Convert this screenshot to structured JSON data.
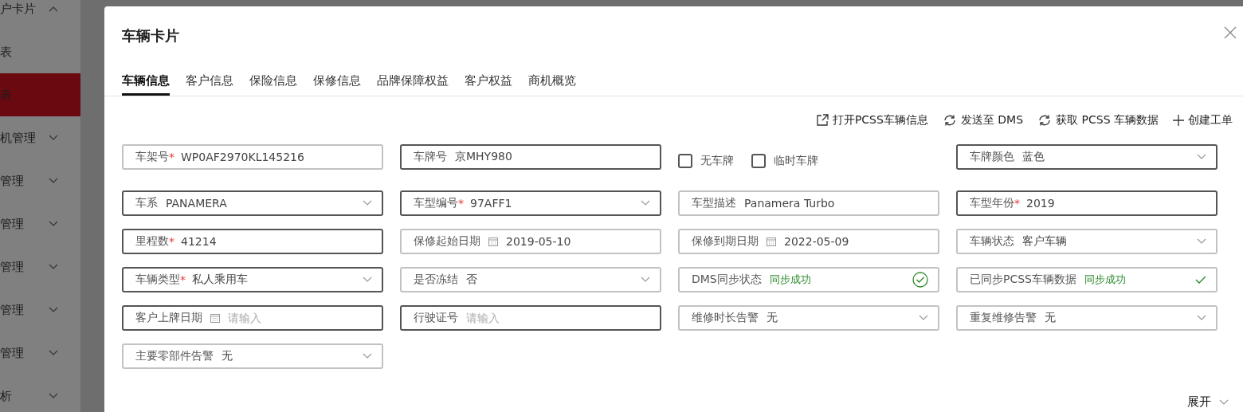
{
  "sidebar": {
    "items": [
      {
        "kind": "group",
        "label": "户卡片",
        "expanded": true,
        "selected": false
      },
      {
        "kind": "leaf",
        "label": "表",
        "selected": false
      },
      {
        "kind": "leaf",
        "label": "表",
        "selected": true
      },
      {
        "kind": "group",
        "label": "机管理",
        "expanded": false,
        "selected": false
      },
      {
        "kind": "group",
        "label": "管理",
        "expanded": false,
        "selected": false
      },
      {
        "kind": "group",
        "label": "管理",
        "expanded": false,
        "selected": false
      },
      {
        "kind": "group",
        "label": "管理",
        "expanded": false,
        "selected": false
      },
      {
        "kind": "group",
        "label": "管理",
        "expanded": false,
        "selected": false
      },
      {
        "kind": "group",
        "label": "管理",
        "expanded": false,
        "selected": false
      },
      {
        "kind": "group",
        "label": "析",
        "expanded": false,
        "selected": false
      }
    ]
  },
  "dialog": {
    "title": "车辆卡片",
    "tabs": [
      {
        "label": "车辆信息",
        "selected": true
      },
      {
        "label": "客户信息",
        "selected": false
      },
      {
        "label": "保险信息",
        "selected": false
      },
      {
        "label": "保修信息",
        "selected": false
      },
      {
        "label": "品牌保障权益",
        "selected": false
      },
      {
        "label": "客户权益",
        "selected": false
      },
      {
        "label": "商机概览",
        "selected": false
      }
    ],
    "actions": [
      {
        "kind": "open",
        "label": "打开PCSS车辆信息"
      },
      {
        "kind": "sync",
        "label": "发送至 DMS"
      },
      {
        "kind": "sync",
        "label": "获取 PCSS 车辆数据"
      },
      {
        "kind": "add",
        "label": "创建工单"
      }
    ],
    "fields": [
      {
        "kind": "text",
        "label": "车架号",
        "required": true,
        "value": "WP0AF2970KL145216",
        "disabled": true
      },
      {
        "kind": "text",
        "label": "车牌号",
        "required": false,
        "value": "京MHY980",
        "disabled": false
      },
      {
        "kind": "checkboxes",
        "options": [
          {
            "label": "无车牌",
            "checked": false
          },
          {
            "label": "临时车牌",
            "checked": false
          }
        ]
      },
      {
        "kind": "select",
        "label": "车牌颜色",
        "required": false,
        "value": "蓝色",
        "disabled": false
      },
      {
        "kind": "select",
        "label": "车系",
        "required": false,
        "value": "PANAMERA",
        "disabled": false
      },
      {
        "kind": "select",
        "label": "车型编号",
        "required": true,
        "value": "97AFF1",
        "disabled": false
      },
      {
        "kind": "text",
        "label": "车型描述",
        "required": false,
        "value": "Panamera Turbo",
        "disabled": true
      },
      {
        "kind": "text",
        "label": "车型年份",
        "required": true,
        "value": "2019",
        "disabled": false
      },
      {
        "kind": "text",
        "label": "里程数",
        "required": true,
        "value": "41214",
        "disabled": false
      },
      {
        "kind": "date",
        "label": "保修起始日期",
        "required": false,
        "value": "2019-05-10",
        "disabled": true
      },
      {
        "kind": "date",
        "label": "保修到期日期",
        "required": false,
        "value": "2022-05-09",
        "disabled": true
      },
      {
        "kind": "select",
        "label": "车辆状态",
        "required": false,
        "value": "客户车辆",
        "disabled": true
      },
      {
        "kind": "select",
        "label": "车辆类型",
        "required": true,
        "value": "私人乘用车",
        "disabled": false
      },
      {
        "kind": "select",
        "label": "是否冻结",
        "required": false,
        "value": "否",
        "disabled": true
      },
      {
        "kind": "status",
        "label": "DMS同步状态",
        "required": false,
        "value": "同步成功",
        "disabled": true
      },
      {
        "kind": "tick",
        "label": "已同步PCSS车辆数据",
        "required": false,
        "value": "同步成功",
        "disabled": true
      },
      {
        "kind": "date",
        "label": "客户上牌日期",
        "required": false,
        "placeholder": "请输入",
        "disabled": false
      },
      {
        "kind": "text",
        "label": "行驶证号",
        "required": false,
        "placeholder": "请输入",
        "disabled": false
      },
      {
        "kind": "select",
        "label": "维修时长告警",
        "required": false,
        "value": "无",
        "disabled": true
      },
      {
        "kind": "select",
        "label": "重复维修告警",
        "required": false,
        "value": "无",
        "disabled": true
      },
      {
        "kind": "select",
        "label": "主要零部件告警",
        "required": false,
        "value": "无",
        "disabled": true
      }
    ],
    "required_mark": "*",
    "expand_label": "展开"
  }
}
